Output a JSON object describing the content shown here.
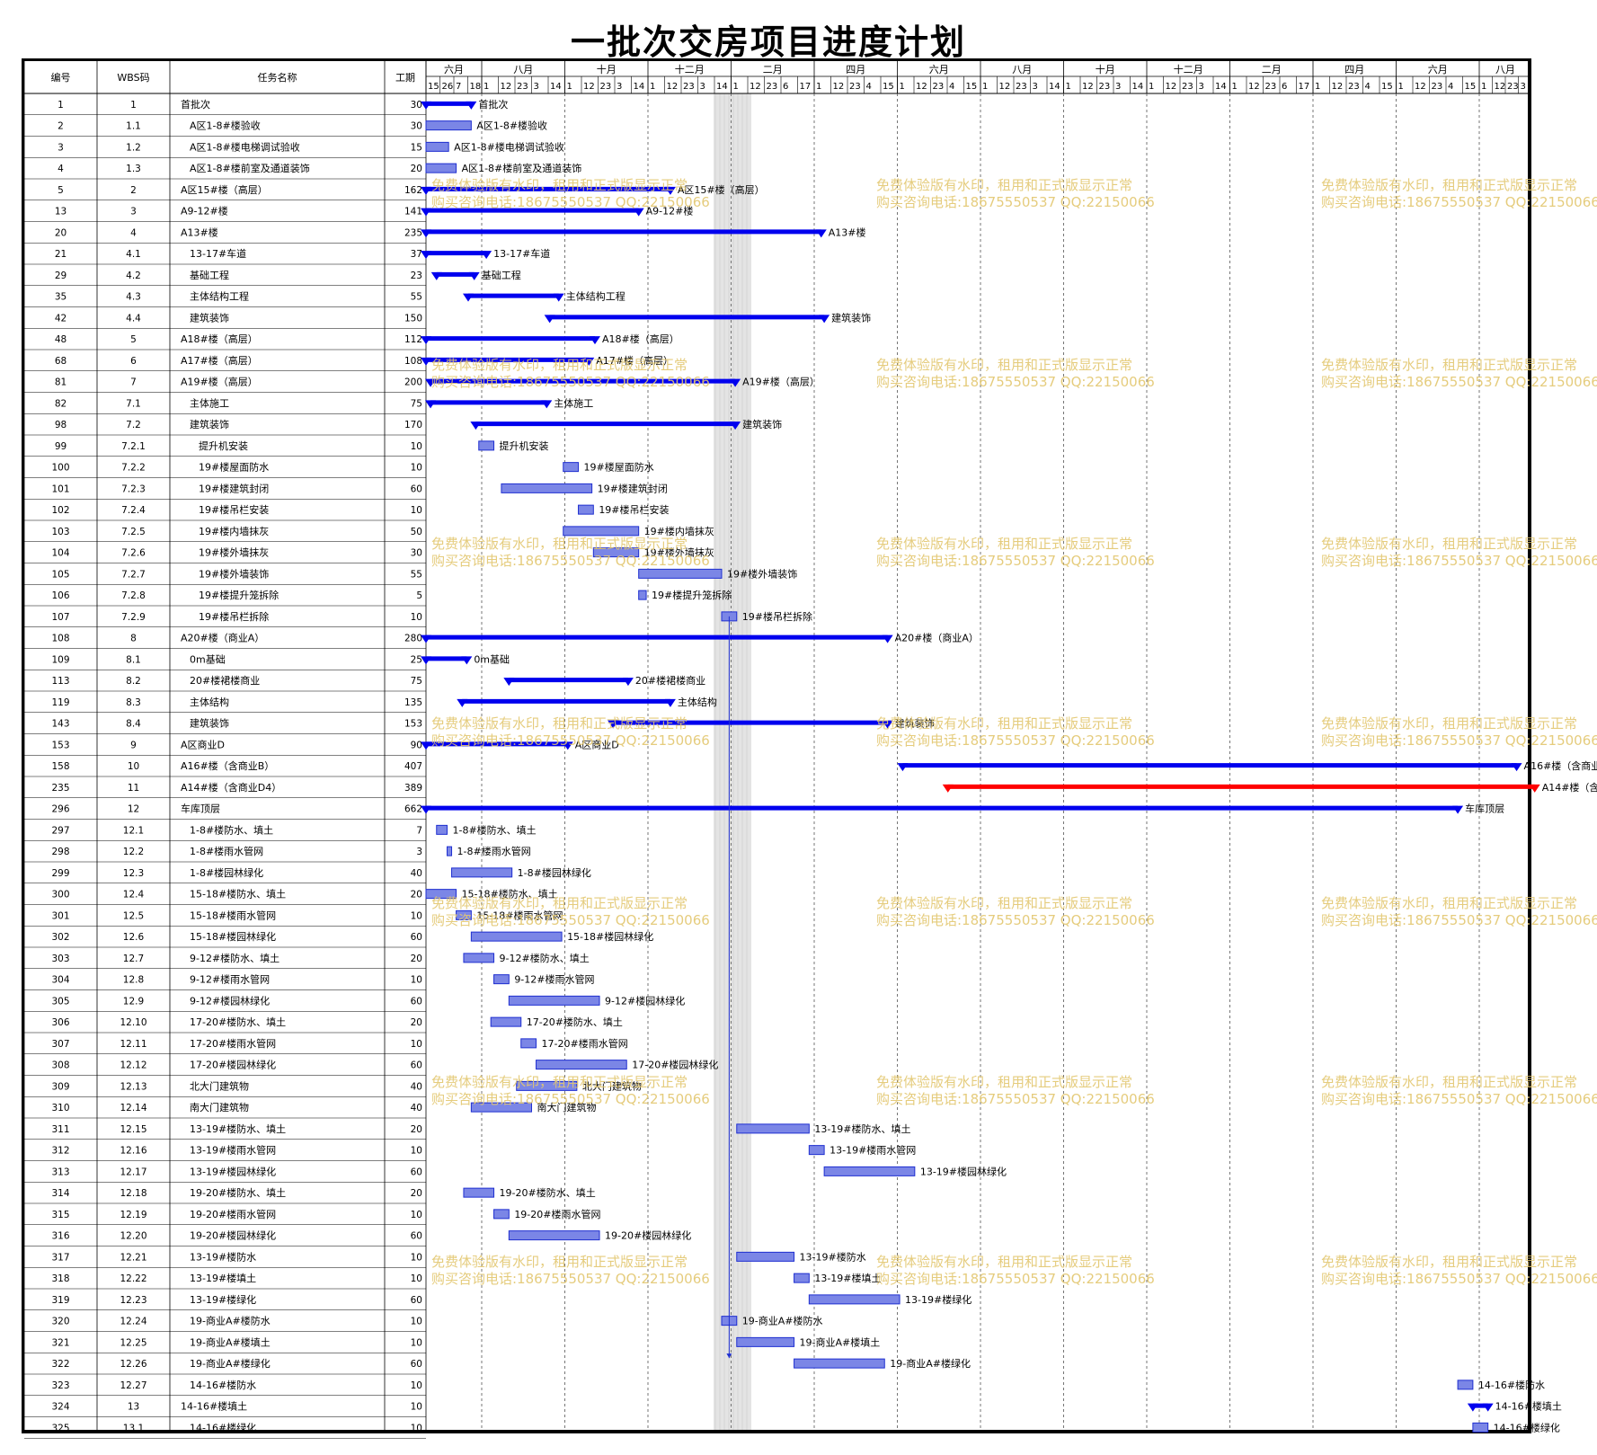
{
  "title": "一批次交房项目进度计划",
  "columns": {
    "id": "编号",
    "wbs": "WBS码",
    "name": "任务名称",
    "dur": "工期"
  },
  "timescale": {
    "months": [
      "六月",
      "八月",
      "十月",
      "十二月",
      "二月",
      "四月",
      "六月",
      "八月",
      "十月",
      "十二月",
      "二月",
      "四月",
      "六月",
      "八月"
    ],
    "ticks": [
      [
        "15",
        "26",
        "7",
        "18"
      ],
      [
        "1",
        "12",
        "23",
        "3",
        "14"
      ],
      [
        "1",
        "12",
        "23",
        "3",
        "14"
      ],
      [
        "1",
        "12",
        "23",
        "3",
        "14"
      ],
      [
        "1",
        "12",
        "23",
        "6",
        "17"
      ],
      [
        "1",
        "12",
        "23",
        "4",
        "15"
      ],
      [
        "1",
        "12",
        "23",
        "4",
        "15"
      ],
      [
        "1",
        "12",
        "23",
        "3",
        "14"
      ],
      [
        "1",
        "12",
        "23",
        "3",
        "14"
      ],
      [
        "1",
        "12",
        "23",
        "3",
        "14"
      ],
      [
        "1",
        "12",
        "23",
        "6",
        "17"
      ],
      [
        "1",
        "12",
        "23",
        "4",
        "15"
      ],
      [
        "1",
        "12",
        "23",
        "4",
        "15"
      ],
      [
        "1",
        "12",
        "23",
        "3"
      ]
    ]
  },
  "colors": {
    "summary": "#0000ee",
    "critical": "#ff0000",
    "task_fill": "#7b86e6",
    "task_border": "#1f2fd0",
    "grid": "#555555",
    "watermark": "#e3c770"
  },
  "watermark": {
    "line1": "免费体验版有水印，租用和正式版显示正常",
    "line2": "购买咨询电话:18675550537 QQ:22150066"
  },
  "tasks": [
    {
      "id": "1",
      "wbs": "1",
      "name": "首批次",
      "dur": "30",
      "type": "summary",
      "start": 0,
      "finish": 30,
      "label": "首批次"
    },
    {
      "id": "2",
      "wbs": "1.1",
      "name": "A区1-8#楼验收",
      "dur": "30",
      "type": "task",
      "start": 0,
      "finish": 30,
      "label": "A区1-8#楼验收"
    },
    {
      "id": "3",
      "wbs": "1.2",
      "name": "A区1-8#楼电梯调试验收",
      "dur": "15",
      "type": "task",
      "start": 0,
      "finish": 15,
      "label": "A区1-8#楼电梯调试验收"
    },
    {
      "id": "4",
      "wbs": "1.3",
      "name": "A区1-8#楼前室及通道装饰",
      "dur": "20",
      "type": "task",
      "start": 0,
      "finish": 20,
      "label": "A区1-8#楼前室及通道装饰"
    },
    {
      "id": "5",
      "wbs": "2",
      "name": "A区15#楼（高层）",
      "dur": "162",
      "type": "summary",
      "start": 0,
      "finish": 162,
      "label": "A区15#楼（高层）"
    },
    {
      "id": "13",
      "wbs": "3",
      "name": "A9-12#楼",
      "dur": "141",
      "type": "summary",
      "start": 0,
      "finish": 141,
      "label": "A9-12#楼"
    },
    {
      "id": "20",
      "wbs": "4",
      "name": "A13#楼",
      "dur": "235",
      "type": "summary",
      "start": 0,
      "finish": 262,
      "label": "A13#楼"
    },
    {
      "id": "21",
      "wbs": "4.1",
      "name": "13-17#车道",
      "dur": "37",
      "type": "summary",
      "start": 0,
      "finish": 40,
      "label": "13-17#车道"
    },
    {
      "id": "29",
      "wbs": "4.2",
      "name": "基础工程",
      "dur": "23",
      "type": "summary",
      "start": 7,
      "finish": 32,
      "label": "基础工程"
    },
    {
      "id": "35",
      "wbs": "4.3",
      "name": "主体结构工程",
      "dur": "55",
      "type": "summary",
      "start": 28,
      "finish": 88,
      "label": "主体结构工程"
    },
    {
      "id": "42",
      "wbs": "4.4",
      "name": "建筑装饰",
      "dur": "150",
      "type": "summary",
      "start": 82,
      "finish": 264,
      "label": "建筑装饰"
    },
    {
      "id": "48",
      "wbs": "5",
      "name": "A18#楼（高层）",
      "dur": "112",
      "type": "summary",
      "start": 0,
      "finish": 112,
      "label": "A18#楼（高层）"
    },
    {
      "id": "68",
      "wbs": "6",
      "name": "A17#楼（高层）",
      "dur": "108",
      "type": "summary",
      "start": 0,
      "finish": 108,
      "label": "A17#楼（高层）"
    },
    {
      "id": "81",
      "wbs": "7",
      "name": "A19#楼（高层）",
      "dur": "200",
      "type": "summary",
      "start": 3,
      "finish": 205,
      "label": "A19#楼（高层）"
    },
    {
      "id": "82",
      "wbs": "7.1",
      "name": "主体施工",
      "dur": "75",
      "type": "summary",
      "start": 3,
      "finish": 80,
      "label": "主体施工"
    },
    {
      "id": "98",
      "wbs": "7.2",
      "name": "建筑装饰",
      "dur": "170",
      "type": "summary",
      "start": 33,
      "finish": 205,
      "label": "建筑装饰"
    },
    {
      "id": "99",
      "wbs": "7.2.1",
      "name": "提升机安装",
      "dur": "10",
      "type": "task",
      "start": 35,
      "finish": 45,
      "label": "提升机安装"
    },
    {
      "id": "100",
      "wbs": "7.2.2",
      "name": "19#楼屋面防水",
      "dur": "10",
      "type": "task",
      "start": 91,
      "finish": 101,
      "label": "19#楼屋面防水"
    },
    {
      "id": "101",
      "wbs": "7.2.3",
      "name": "19#楼建筑封闭",
      "dur": "60",
      "type": "task",
      "start": 50,
      "finish": 110,
      "label": "19#楼建筑封闭"
    },
    {
      "id": "102",
      "wbs": "7.2.4",
      "name": "19#楼吊栏安装",
      "dur": "10",
      "type": "task",
      "start": 101,
      "finish": 111,
      "label": "19#楼吊栏安装"
    },
    {
      "id": "103",
      "wbs": "7.2.5",
      "name": "19#楼内墙抹灰",
      "dur": "50",
      "type": "task",
      "start": 91,
      "finish": 141,
      "label": "19#楼内墙抹灰"
    },
    {
      "id": "104",
      "wbs": "7.2.6",
      "name": "19#楼外墙抹灰",
      "dur": "30",
      "type": "task",
      "start": 111,
      "finish": 141,
      "label": "19#楼外墙抹灰"
    },
    {
      "id": "105",
      "wbs": "7.2.7",
      "name": "19#楼外墙装饰",
      "dur": "55",
      "type": "task",
      "start": 141,
      "finish": 196,
      "label": "19#楼外墙装饰"
    },
    {
      "id": "106",
      "wbs": "7.2.8",
      "name": "19#楼提升笼拆除",
      "dur": "5",
      "type": "task",
      "start": 141,
      "finish": 146,
      "label": "19#楼提升笼拆除"
    },
    {
      "id": "107",
      "wbs": "7.2.9",
      "name": "19#楼吊栏拆除",
      "dur": "10",
      "type": "task",
      "start": 196,
      "finish": 206,
      "label": "19#楼吊栏拆除"
    },
    {
      "id": "108",
      "wbs": "8",
      "name": "A20#楼（商业A）",
      "dur": "280",
      "type": "summary",
      "start": 0,
      "finish": 306,
      "label": "A20#楼（商业A）"
    },
    {
      "id": "109",
      "wbs": "8.1",
      "name": "0m基础",
      "dur": "25",
      "type": "summary",
      "start": 0,
      "finish": 27,
      "label": "0m基础"
    },
    {
      "id": "113",
      "wbs": "8.2",
      "name": "20#楼裙楼商业",
      "dur": "75",
      "type": "summary",
      "start": 55,
      "finish": 134,
      "label": "20#楼裙楼商业"
    },
    {
      "id": "119",
      "wbs": "8.3",
      "name": "主体结构",
      "dur": "135",
      "type": "summary",
      "start": 24,
      "finish": 162,
      "label": "主体结构"
    },
    {
      "id": "143",
      "wbs": "8.4",
      "name": "建筑装饰",
      "dur": "153",
      "type": "summary",
      "start": 124,
      "finish": 306,
      "label": "建筑装饰"
    },
    {
      "id": "153",
      "wbs": "9",
      "name": "A区商业D",
      "dur": "90",
      "type": "summary",
      "start": 0,
      "finish": 94,
      "label": "A区商业D"
    },
    {
      "id": "158",
      "wbs": "10",
      "name": "A16#楼（含商业B）",
      "dur": "407",
      "type": "summary",
      "start": 316,
      "finish": 723,
      "label": "A16#楼（含商业B）"
    },
    {
      "id": "235",
      "wbs": "11",
      "name": "A14#楼（含商业D4）",
      "dur": "389",
      "type": "critical",
      "start": 346,
      "finish": 735,
      "label": "A14#楼（含商业D4）"
    },
    {
      "id": "296",
      "wbs": "12",
      "name": "车库顶层",
      "dur": "662",
      "type": "summary",
      "start": 0,
      "finish": 684,
      "label": "车库顶层"
    },
    {
      "id": "297",
      "wbs": "12.1",
      "name": "1-8#楼防水、填土",
      "dur": "7",
      "type": "task",
      "start": 7,
      "finish": 14,
      "label": "1-8#楼防水、填土"
    },
    {
      "id": "298",
      "wbs": "12.2",
      "name": "1-8#楼雨水管网",
      "dur": "3",
      "type": "task",
      "start": 14,
      "finish": 17,
      "label": "1-8#楼雨水管网"
    },
    {
      "id": "299",
      "wbs": "12.3",
      "name": "1-8#楼园林绿化",
      "dur": "40",
      "type": "task",
      "start": 17,
      "finish": 57,
      "label": "1-8#楼园林绿化"
    },
    {
      "id": "300",
      "wbs": "12.4",
      "name": "15-18#楼防水、填土",
      "dur": "20",
      "type": "task",
      "start": 0,
      "finish": 20,
      "label": "15-18#楼防水、填土"
    },
    {
      "id": "301",
      "wbs": "12.5",
      "name": "15-18#楼雨水管网",
      "dur": "10",
      "type": "task",
      "start": 20,
      "finish": 30,
      "label": "15-18#楼雨水管网"
    },
    {
      "id": "302",
      "wbs": "12.6",
      "name": "15-18#楼园林绿化",
      "dur": "60",
      "type": "task",
      "start": 30,
      "finish": 90,
      "label": "15-18#楼园林绿化"
    },
    {
      "id": "303",
      "wbs": "12.7",
      "name": "9-12#楼防水、填土",
      "dur": "20",
      "type": "task",
      "start": 25,
      "finish": 45,
      "label": "9-12#楼防水、填土"
    },
    {
      "id": "304",
      "wbs": "12.8",
      "name": "9-12#楼雨水管网",
      "dur": "10",
      "type": "task",
      "start": 45,
      "finish": 55,
      "label": "9-12#楼雨水管网"
    },
    {
      "id": "305",
      "wbs": "12.9",
      "name": "9-12#楼园林绿化",
      "dur": "60",
      "type": "task",
      "start": 55,
      "finish": 115,
      "label": "9-12#楼园林绿化"
    },
    {
      "id": "306",
      "wbs": "12.10",
      "name": "17-20#楼防水、填土",
      "dur": "20",
      "type": "task",
      "start": 43,
      "finish": 63,
      "label": "17-20#楼防水、填土"
    },
    {
      "id": "307",
      "wbs": "12.11",
      "name": "17-20#楼雨水管网",
      "dur": "10",
      "type": "task",
      "start": 63,
      "finish": 73,
      "label": "17-20#楼雨水管网"
    },
    {
      "id": "308",
      "wbs": "12.12",
      "name": "17-20#楼园林绿化",
      "dur": "60",
      "type": "task",
      "start": 73,
      "finish": 133,
      "label": "17-20#楼园林绿化"
    },
    {
      "id": "309",
      "wbs": "12.13",
      "name": "北大门建筑物",
      "dur": "40",
      "type": "task",
      "start": 60,
      "finish": 100,
      "label": "北大门建筑物"
    },
    {
      "id": "310",
      "wbs": "12.14",
      "name": "南大门建筑物",
      "dur": "40",
      "type": "task",
      "start": 30,
      "finish": 70,
      "label": "南大门建筑物"
    },
    {
      "id": "311",
      "wbs": "12.15",
      "name": "13-19#楼防水、填土",
      "dur": "20",
      "type": "task",
      "start": 206,
      "finish": 254,
      "label": "13-19#楼防水、填土"
    },
    {
      "id": "312",
      "wbs": "12.16",
      "name": "13-19#楼雨水管网",
      "dur": "10",
      "type": "task",
      "start": 254,
      "finish": 264,
      "label": "13-19#楼雨水管网"
    },
    {
      "id": "313",
      "wbs": "12.17",
      "name": "13-19#楼园林绿化",
      "dur": "60",
      "type": "task",
      "start": 264,
      "finish": 324,
      "label": "13-19#楼园林绿化"
    },
    {
      "id": "314",
      "wbs": "12.18",
      "name": "19-20#楼防水、填土",
      "dur": "20",
      "type": "task",
      "start": 25,
      "finish": 45,
      "label": "19-20#楼防水、填土"
    },
    {
      "id": "315",
      "wbs": "12.19",
      "name": "19-20#楼雨水管网",
      "dur": "10",
      "type": "task",
      "start": 45,
      "finish": 55,
      "label": "19-20#楼雨水管网"
    },
    {
      "id": "316",
      "wbs": "12.20",
      "name": "19-20#楼园林绿化",
      "dur": "60",
      "type": "task",
      "start": 55,
      "finish": 115,
      "label": "19-20#楼园林绿化"
    },
    {
      "id": "317",
      "wbs": "12.21",
      "name": "13-19#楼防水",
      "dur": "10",
      "type": "task",
      "start": 206,
      "finish": 244,
      "label": "13-19#楼防水"
    },
    {
      "id": "318",
      "wbs": "12.22",
      "name": "13-19#楼填土",
      "dur": "10",
      "type": "task",
      "start": 244,
      "finish": 254,
      "label": "13-19#楼填土"
    },
    {
      "id": "319",
      "wbs": "12.23",
      "name": "13-19#楼绿化",
      "dur": "60",
      "type": "task",
      "start": 254,
      "finish": 314,
      "label": "13-19#楼绿化"
    },
    {
      "id": "320",
      "wbs": "12.24",
      "name": "19-商业A#楼防水",
      "dur": "10",
      "type": "task",
      "start": 196,
      "finish": 206,
      "label": "19-商业A#楼防水"
    },
    {
      "id": "321",
      "wbs": "12.25",
      "name": "19-商业A#楼填土",
      "dur": "10",
      "type": "task",
      "start": 206,
      "finish": 244,
      "label": "19-商业A#楼填土"
    },
    {
      "id": "322",
      "wbs": "12.26",
      "name": "19-商业A#楼绿化",
      "dur": "60",
      "type": "task",
      "start": 244,
      "finish": 304,
      "label": "19-商业A#楼绿化"
    },
    {
      "id": "323",
      "wbs": "12.27",
      "name": "14-16#楼防水",
      "dur": "10",
      "type": "task",
      "start": 684,
      "finish": 694,
      "label": "14-16#楼防水"
    },
    {
      "id": "324",
      "wbs": "13",
      "name": "14-16#楼填土",
      "dur": "10",
      "type": "summary",
      "start": 694,
      "finish": 704,
      "label": "14-16#楼填土"
    },
    {
      "id": "325",
      "wbs": "13.1",
      "name": "14-16#楼绿化",
      "dur": "10",
      "type": "task",
      "start": 694,
      "finish": 704,
      "label": "14-16#楼绿化"
    }
  ]
}
